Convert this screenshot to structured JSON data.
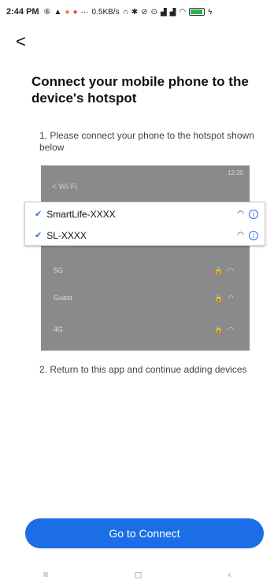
{
  "status_bar": {
    "time": "2:44 PM",
    "network_speed": "0.5KB/s",
    "icons": [
      "sim-icon",
      "alert-icon",
      "orange-dot-icon",
      "red-dot-icon",
      "more-icon",
      "headphone-icon",
      "bluetooth-icon",
      "mute-icon",
      "alarm-icon",
      "signal-icon",
      "signal-icon",
      "wifi-icon",
      "battery-icon",
      "charging-icon"
    ]
  },
  "header": {
    "back_symbol": "<"
  },
  "content": {
    "title": "Connect your mobile phone to the device's hotspot",
    "step1": "1. Please connect your phone to the hotspot shown below",
    "step2": "2. Return to this app and continue adding devices"
  },
  "illustration": {
    "phone_time": "12:30",
    "wifi_header": "< Wi-Fi",
    "hidden_row_label": "Home",
    "networks": [
      {
        "label": "5G"
      },
      {
        "label": "Guest"
      },
      {
        "label": "4G"
      }
    ],
    "highlighted_networks": [
      {
        "label": "SmartLife-XXXX",
        "checked": true
      },
      {
        "label": "SL-XXXX",
        "checked": true
      }
    ]
  },
  "actions": {
    "connect_label": "Go to Connect"
  },
  "nav_bar": {
    "menu_symbol": "≡",
    "home_symbol": "◻",
    "back_symbol": "‹"
  },
  "colors": {
    "accent": "#1b6ee6",
    "check": "#2b6fe0",
    "illustration_bg": "#8a8a8a"
  }
}
